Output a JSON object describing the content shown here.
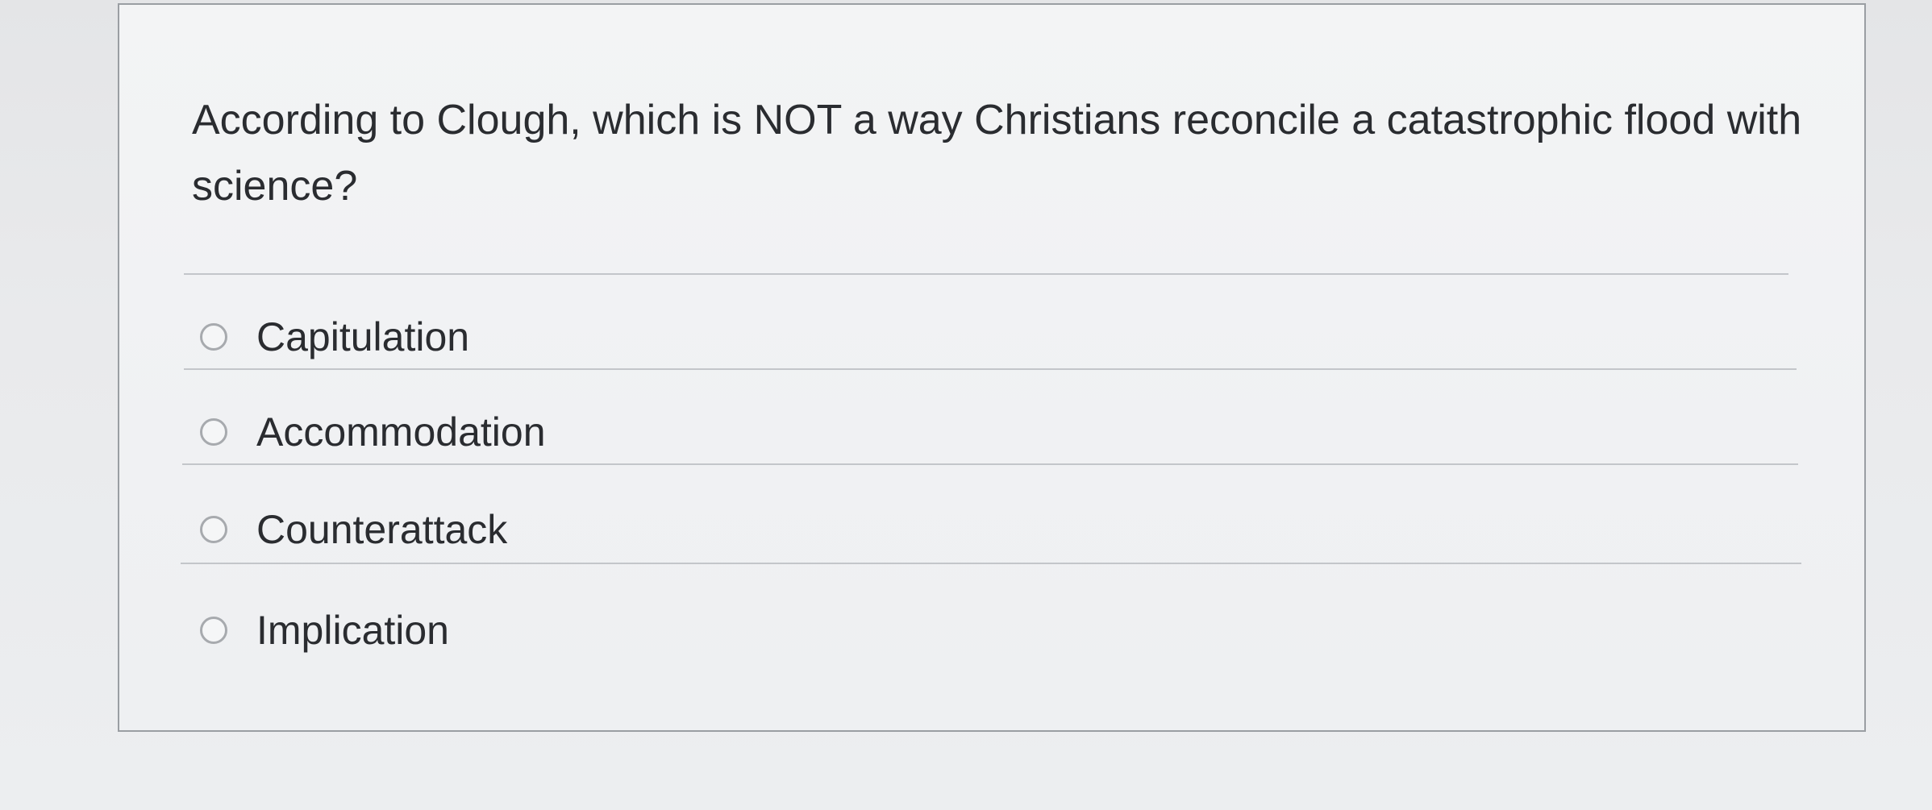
{
  "question": {
    "text": "According to Clough, which is NOT a way Christians reconcile a catastrophic flood with science?"
  },
  "options": [
    {
      "label": "Capitulation",
      "selected": false
    },
    {
      "label": "Accommodation",
      "selected": false
    },
    {
      "label": "Counterattack",
      "selected": false
    },
    {
      "label": "Implication",
      "selected": false
    }
  ]
}
